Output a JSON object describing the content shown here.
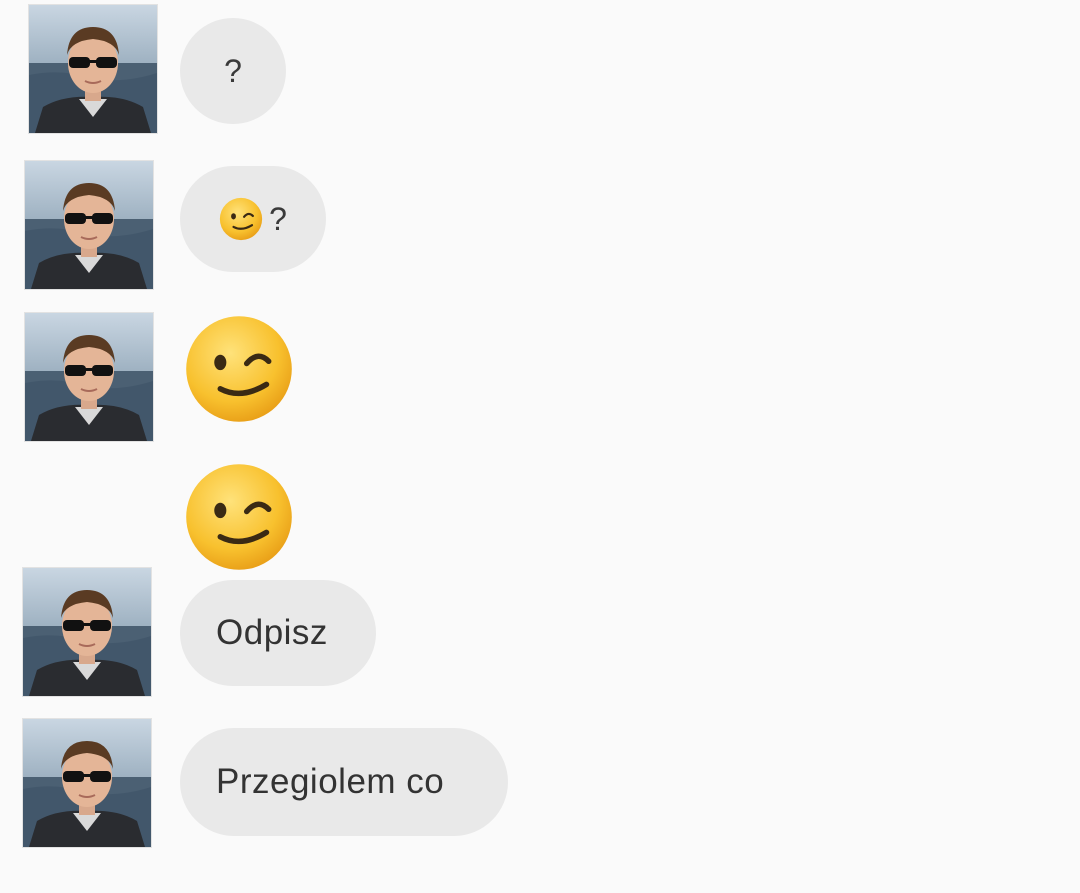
{
  "conversation": {
    "messages": [
      {
        "type": "text",
        "text": "?",
        "has_avatar": true
      },
      {
        "type": "emoji_text",
        "emoji": "wink-emoji",
        "text": "?",
        "has_avatar": true
      },
      {
        "type": "emoji",
        "emoji": "wink-emoji",
        "has_avatar": true
      },
      {
        "type": "emoji",
        "emoji": "wink-emoji",
        "has_avatar": false
      },
      {
        "type": "text",
        "text": "Odpisz",
        "has_avatar": true
      },
      {
        "type": "text",
        "text": "Przegiolem co",
        "has_avatar": true
      }
    ]
  },
  "colors": {
    "background": "#fafafa",
    "bubble": "#e9e9e9",
    "text": "#333333",
    "emoji_face": "#f7c531"
  }
}
